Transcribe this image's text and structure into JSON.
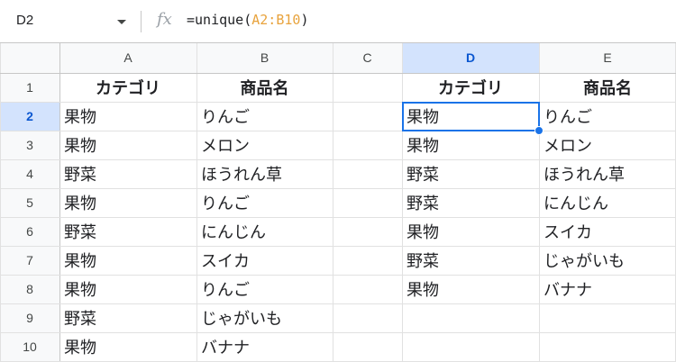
{
  "name_box": {
    "value": "D2"
  },
  "formula_bar": {
    "fx_label": "fx",
    "fn_open": "=unique(",
    "range": "A2:B10",
    "fn_close": ")"
  },
  "columns": [
    "A",
    "B",
    "C",
    "D",
    "E"
  ],
  "rows": [
    "1",
    "2",
    "3",
    "4",
    "5",
    "6",
    "7",
    "8",
    "9",
    "10"
  ],
  "selection": {
    "cell": "D2",
    "column": "D",
    "row": "2"
  },
  "colors": {
    "selection": "#1a73e8",
    "formula_range": "#e8a33d",
    "header_selected_bg": "#d3e3fd"
  },
  "cells": {
    "A": [
      "カテゴリ",
      "果物",
      "果物",
      "野菜",
      "果物",
      "野菜",
      "果物",
      "果物",
      "野菜",
      "果物"
    ],
    "B": [
      "商品名",
      "りんご",
      "メロン",
      "ほうれん草",
      "りんご",
      "にんじん",
      "スイカ",
      "りんご",
      "じゃがいも",
      "バナナ"
    ],
    "C": [
      "",
      "",
      "",
      "",
      "",
      "",
      "",
      "",
      "",
      ""
    ],
    "D": [
      "カテゴリ",
      "果物",
      "果物",
      "野菜",
      "野菜",
      "果物",
      "野菜",
      "果物",
      "",
      ""
    ],
    "E": [
      "商品名",
      "りんご",
      "メロン",
      "ほうれん草",
      "にんじん",
      "スイカ",
      "じゃがいも",
      "バナナ",
      "",
      ""
    ]
  }
}
